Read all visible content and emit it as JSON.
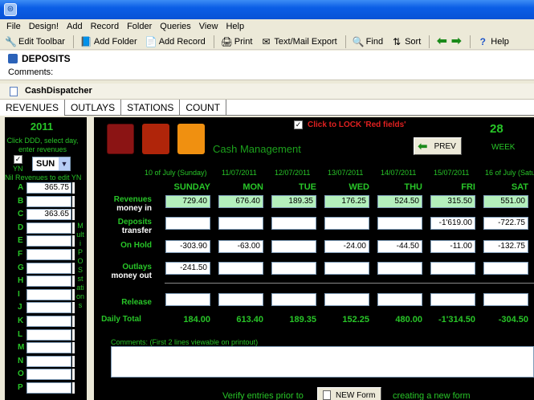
{
  "menu": [
    "File",
    "Design!",
    "Add",
    "Record",
    "Folder",
    "Queries",
    "View",
    "Help"
  ],
  "toolbar": {
    "edit_toolbar": "Edit Toolbar",
    "add_folder": "Add Folder",
    "add_record": "Add Record",
    "print": "Print",
    "text_mail_export": "Text/Mail Export",
    "find": "Find",
    "sort": "Sort",
    "help": "Help"
  },
  "record": {
    "title": "DEPOSITS",
    "comments_label": "Comments:"
  },
  "form_name": "CashDispatcher",
  "tabs": [
    "REVENUES",
    "OUTLAYS",
    "STATIONS",
    "COUNT"
  ],
  "left": {
    "year": "2011",
    "hint": "Click DDD, select day, enter revenues",
    "yn_label": "YN",
    "day_value": "SUN",
    "nil_label": "Nil Revenues to edit YN",
    "multi_pos_label": "Multi POS stations",
    "stations": [
      {
        "letter": "A",
        "value": "365.75"
      },
      {
        "letter": "B",
        "value": ""
      },
      {
        "letter": "C",
        "value": "363.65"
      },
      {
        "letter": "D",
        "value": ""
      },
      {
        "letter": "E",
        "value": ""
      },
      {
        "letter": "F",
        "value": ""
      },
      {
        "letter": "G",
        "value": ""
      },
      {
        "letter": "H",
        "value": ""
      },
      {
        "letter": "I",
        "value": ""
      },
      {
        "letter": "J",
        "value": ""
      },
      {
        "letter": "K",
        "value": ""
      },
      {
        "letter": "L",
        "value": ""
      },
      {
        "letter": "M",
        "value": ""
      },
      {
        "letter": "N",
        "value": ""
      },
      {
        "letter": "O",
        "value": ""
      },
      {
        "letter": "P",
        "value": ""
      }
    ]
  },
  "main": {
    "title": "Cash Management",
    "lock_label": "Click to LOCK 'Red fields'",
    "prev_label": "PREV",
    "week_number": "28",
    "week_label": "WEEK",
    "dates": [
      "10 of July (Sunday)",
      "11/07/2011",
      "12/07/2011",
      "13/07/2011",
      "14/07/2011",
      "15/07/2011",
      "16 of July (Saturday)"
    ],
    "days": [
      "SUNDAY",
      "MON",
      "TUE",
      "WED",
      "THU",
      "FRI",
      "SAT"
    ],
    "row_labels": {
      "revenues": "Revenues",
      "revenues_sub": "money in",
      "deposits": "Deposits",
      "deposits_sub": "transfer",
      "on_hold": "On Hold",
      "outlays": "Outlays",
      "outlays_sub": "money out",
      "release": "Release",
      "daily_total": "Daily Total"
    },
    "revenues": [
      "729.40",
      "676.40",
      "189.35",
      "176.25",
      "524.50",
      "315.50",
      "551.00"
    ],
    "deposits": [
      "",
      "",
      "",
      "",
      "",
      "-1'619.00",
      "-722.75"
    ],
    "on_hold": [
      "-303.90",
      "-63.00",
      "",
      "-24.00",
      "-44.50",
      "-11.00",
      "-132.75"
    ],
    "outlays": [
      "-241.50",
      "",
      "",
      "",
      "",
      "",
      ""
    ],
    "release": [
      "",
      "",
      "",
      "",
      "",
      "",
      ""
    ],
    "totals": [
      "184.00",
      "613.40",
      "189.35",
      "152.25",
      "480.00",
      "-1'314.50",
      "-304.50"
    ],
    "comments_label": "Comments: (First 2 lines viewable on printout)",
    "verify_label": "Verify entries prior to",
    "new_form_label": "NEW Form",
    "creating_label": "creating a new form"
  }
}
